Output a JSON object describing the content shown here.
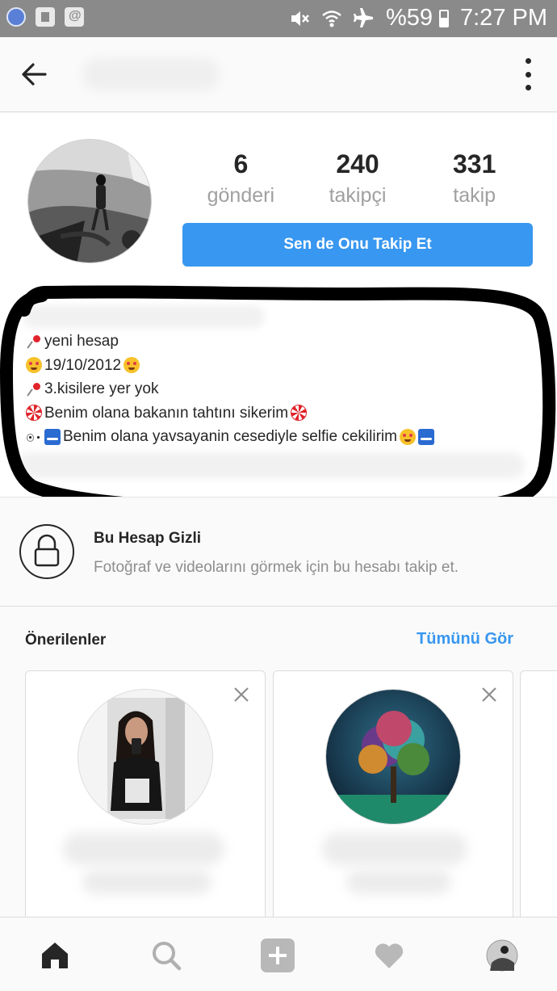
{
  "status_bar": {
    "battery": "%59",
    "time": "7:27 PM"
  },
  "stats": {
    "posts": {
      "count": "6",
      "label": "gönderi"
    },
    "followers": {
      "count": "240",
      "label": "takipçi"
    },
    "following": {
      "count": "331",
      "label": "takip"
    }
  },
  "follow_button": "Sen de Onu Takip Et",
  "bio": [
    "yeni hesap",
    "19/10/2012",
    "3.kisilere yer yok",
    "Benim olana bakanın tahtını sikerim",
    "Benim olana yavsayanin cesediyle selfie cekilirim"
  ],
  "private": {
    "title": "Bu Hesap Gizli",
    "subtitle": "Fotoğraf ve videolarını görmek için bu hesabı takip et."
  },
  "suggestions": {
    "title": "Önerilenler",
    "see_all": "Tümünü Gör"
  },
  "icons": {
    "nav": [
      "back-arrow-icon",
      "more-vertical-icon"
    ],
    "tabs": [
      "home-icon",
      "search-icon",
      "add-icon",
      "heart-icon",
      "profile-icon"
    ],
    "private": "lock-icon"
  },
  "colors": {
    "accent": "#3897f0",
    "annotation": "#000000"
  }
}
